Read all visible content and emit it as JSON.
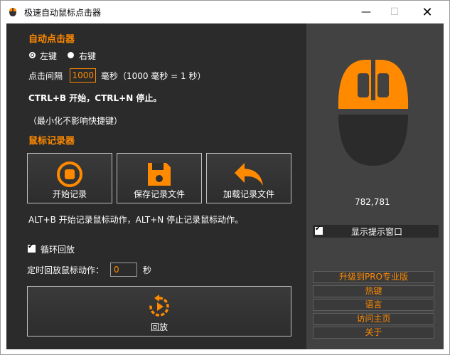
{
  "window": {
    "title": "极速自动鼠标点击器",
    "minimize": "—",
    "maximize": "☐",
    "close": "✕"
  },
  "clicker": {
    "section": "自动点击器",
    "left_key": "左键",
    "right_key": "右键",
    "interval_label": "点击间隔",
    "interval_value": "1000",
    "interval_unit": "毫秒（1000 毫秒 = 1 秒）",
    "hotkey_hint": "CTRL+B 开始，CTRL+N 停止。",
    "minimize_note": "（最小化不影响快捷键）"
  },
  "recorder": {
    "section": "鼠标记录器",
    "start_label": "开始记录",
    "save_label": "保存记录文件",
    "load_label": "加载记录文件",
    "hotkey_hint": "ALT+B 开始记录鼠标动作，ALT+N 停止记录鼠标动作。"
  },
  "playback": {
    "loop_label": "循环回放",
    "loop_checked": true,
    "timer_label": "定时回放鼠标动作：",
    "timer_value": "0",
    "timer_unit": "秒",
    "replay_label": "回放"
  },
  "side": {
    "coords": "782,781",
    "show_tip_label": "显示提示窗口",
    "show_tip_checked": true,
    "links": [
      "升级到PRO专业版",
      "热键",
      "语言",
      "访问主页",
      "关于"
    ]
  },
  "colors": {
    "accent": "#ff8a00",
    "panel": "#2b2b2b",
    "side_panel": "#424242",
    "mouse_body": "#2b2b2b"
  },
  "icons": {
    "app": "mouse-app-icon",
    "start": "record-icon",
    "save": "floppy-disk-icon",
    "load": "undo-arrow-icon",
    "replay": "replay-icon",
    "mouse": "mouse-illustration"
  }
}
